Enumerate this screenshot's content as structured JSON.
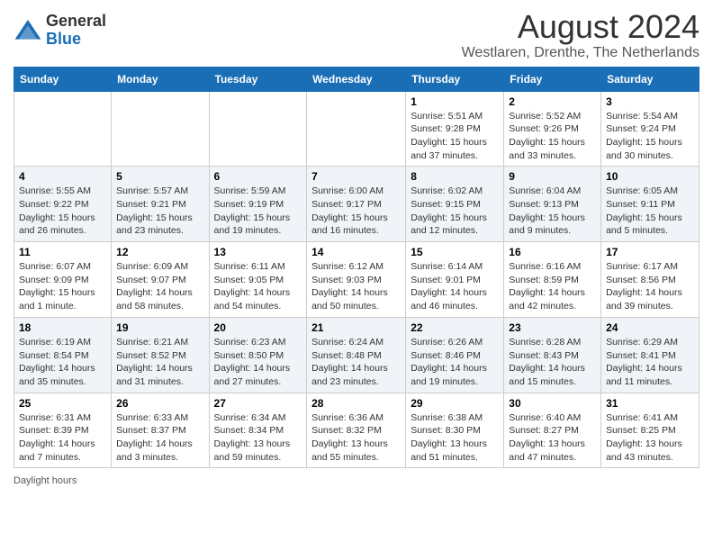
{
  "logo": {
    "general": "General",
    "blue": "Blue"
  },
  "title": "August 2024",
  "location": "Westlaren, Drenthe, The Netherlands",
  "weekdays": [
    "Sunday",
    "Monday",
    "Tuesday",
    "Wednesday",
    "Thursday",
    "Friday",
    "Saturday"
  ],
  "weeks": [
    [
      {
        "day": "",
        "info": ""
      },
      {
        "day": "",
        "info": ""
      },
      {
        "day": "",
        "info": ""
      },
      {
        "day": "",
        "info": ""
      },
      {
        "day": "1",
        "info": "Sunrise: 5:51 AM\nSunset: 9:28 PM\nDaylight: 15 hours and 37 minutes."
      },
      {
        "day": "2",
        "info": "Sunrise: 5:52 AM\nSunset: 9:26 PM\nDaylight: 15 hours and 33 minutes."
      },
      {
        "day": "3",
        "info": "Sunrise: 5:54 AM\nSunset: 9:24 PM\nDaylight: 15 hours and 30 minutes."
      }
    ],
    [
      {
        "day": "4",
        "info": "Sunrise: 5:55 AM\nSunset: 9:22 PM\nDaylight: 15 hours and 26 minutes."
      },
      {
        "day": "5",
        "info": "Sunrise: 5:57 AM\nSunset: 9:21 PM\nDaylight: 15 hours and 23 minutes."
      },
      {
        "day": "6",
        "info": "Sunrise: 5:59 AM\nSunset: 9:19 PM\nDaylight: 15 hours and 19 minutes."
      },
      {
        "day": "7",
        "info": "Sunrise: 6:00 AM\nSunset: 9:17 PM\nDaylight: 15 hours and 16 minutes."
      },
      {
        "day": "8",
        "info": "Sunrise: 6:02 AM\nSunset: 9:15 PM\nDaylight: 15 hours and 12 minutes."
      },
      {
        "day": "9",
        "info": "Sunrise: 6:04 AM\nSunset: 9:13 PM\nDaylight: 15 hours and 9 minutes."
      },
      {
        "day": "10",
        "info": "Sunrise: 6:05 AM\nSunset: 9:11 PM\nDaylight: 15 hours and 5 minutes."
      }
    ],
    [
      {
        "day": "11",
        "info": "Sunrise: 6:07 AM\nSunset: 9:09 PM\nDaylight: 15 hours and 1 minute."
      },
      {
        "day": "12",
        "info": "Sunrise: 6:09 AM\nSunset: 9:07 PM\nDaylight: 14 hours and 58 minutes."
      },
      {
        "day": "13",
        "info": "Sunrise: 6:11 AM\nSunset: 9:05 PM\nDaylight: 14 hours and 54 minutes."
      },
      {
        "day": "14",
        "info": "Sunrise: 6:12 AM\nSunset: 9:03 PM\nDaylight: 14 hours and 50 minutes."
      },
      {
        "day": "15",
        "info": "Sunrise: 6:14 AM\nSunset: 9:01 PM\nDaylight: 14 hours and 46 minutes."
      },
      {
        "day": "16",
        "info": "Sunrise: 6:16 AM\nSunset: 8:59 PM\nDaylight: 14 hours and 42 minutes."
      },
      {
        "day": "17",
        "info": "Sunrise: 6:17 AM\nSunset: 8:56 PM\nDaylight: 14 hours and 39 minutes."
      }
    ],
    [
      {
        "day": "18",
        "info": "Sunrise: 6:19 AM\nSunset: 8:54 PM\nDaylight: 14 hours and 35 minutes."
      },
      {
        "day": "19",
        "info": "Sunrise: 6:21 AM\nSunset: 8:52 PM\nDaylight: 14 hours and 31 minutes."
      },
      {
        "day": "20",
        "info": "Sunrise: 6:23 AM\nSunset: 8:50 PM\nDaylight: 14 hours and 27 minutes."
      },
      {
        "day": "21",
        "info": "Sunrise: 6:24 AM\nSunset: 8:48 PM\nDaylight: 14 hours and 23 minutes."
      },
      {
        "day": "22",
        "info": "Sunrise: 6:26 AM\nSunset: 8:46 PM\nDaylight: 14 hours and 19 minutes."
      },
      {
        "day": "23",
        "info": "Sunrise: 6:28 AM\nSunset: 8:43 PM\nDaylight: 14 hours and 15 minutes."
      },
      {
        "day": "24",
        "info": "Sunrise: 6:29 AM\nSunset: 8:41 PM\nDaylight: 14 hours and 11 minutes."
      }
    ],
    [
      {
        "day": "25",
        "info": "Sunrise: 6:31 AM\nSunset: 8:39 PM\nDaylight: 14 hours and 7 minutes."
      },
      {
        "day": "26",
        "info": "Sunrise: 6:33 AM\nSunset: 8:37 PM\nDaylight: 14 hours and 3 minutes."
      },
      {
        "day": "27",
        "info": "Sunrise: 6:34 AM\nSunset: 8:34 PM\nDaylight: 13 hours and 59 minutes."
      },
      {
        "day": "28",
        "info": "Sunrise: 6:36 AM\nSunset: 8:32 PM\nDaylight: 13 hours and 55 minutes."
      },
      {
        "day": "29",
        "info": "Sunrise: 6:38 AM\nSunset: 8:30 PM\nDaylight: 13 hours and 51 minutes."
      },
      {
        "day": "30",
        "info": "Sunrise: 6:40 AM\nSunset: 8:27 PM\nDaylight: 13 hours and 47 minutes."
      },
      {
        "day": "31",
        "info": "Sunrise: 6:41 AM\nSunset: 8:25 PM\nDaylight: 13 hours and 43 minutes."
      }
    ]
  ],
  "footer": {
    "daylight_label": "Daylight hours"
  }
}
